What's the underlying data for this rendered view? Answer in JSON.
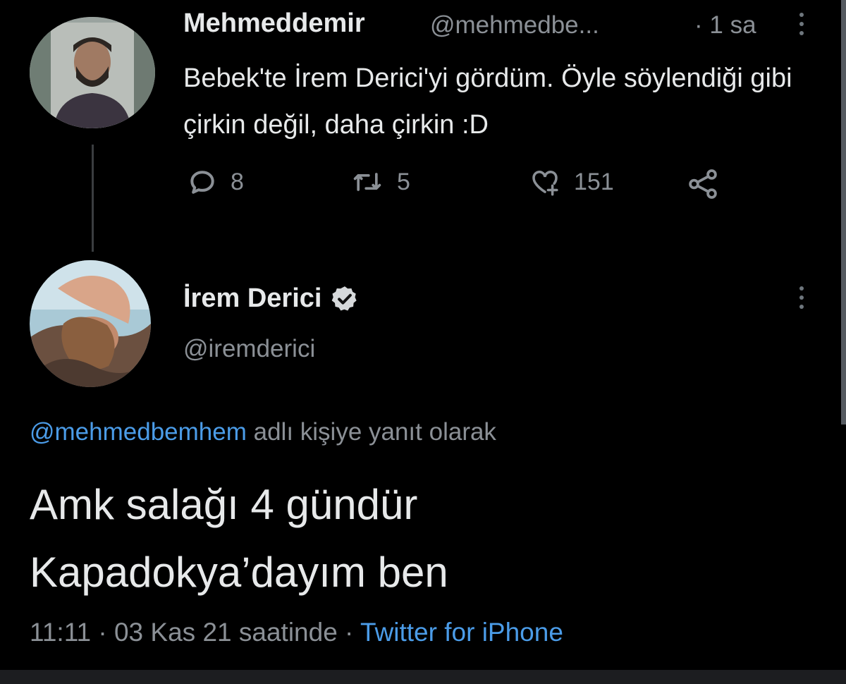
{
  "tweet1": {
    "display_name": "Mehmeddemir",
    "handle": "@mehmedbe...",
    "time": "· 1 sa",
    "text": "Bebek'te İrem Derici'yi gördüm. Öyle söylendiği gibi çirkin değil, daha çirkin :D",
    "reply_count": "8",
    "retweet_count": "5",
    "like_count": "151",
    "icons": [
      "reply-icon",
      "retweet-icon",
      "like-icon",
      "share-icon",
      "more-icon"
    ]
  },
  "tweet2": {
    "display_name": "İrem Derici",
    "handle": "@iremderici",
    "reply_to_handle": "@mehmedbemhem",
    "reply_to_suffix": "adlı kişiye yanıt olarak",
    "text_line1": "Amk salağı 4 gündür",
    "text_line2": "Kapadokya’dayım ben",
    "timestamp": "11:11 · 03 Kas 21 saatinde ·",
    "source": "Twitter for iPhone",
    "icons": [
      "verified-badge-icon",
      "more-icon"
    ]
  },
  "colors": {
    "background": "#000000",
    "primary_text": "#e7e9ea",
    "secondary_text": "#8b9096",
    "link": "#4b9ce8"
  }
}
